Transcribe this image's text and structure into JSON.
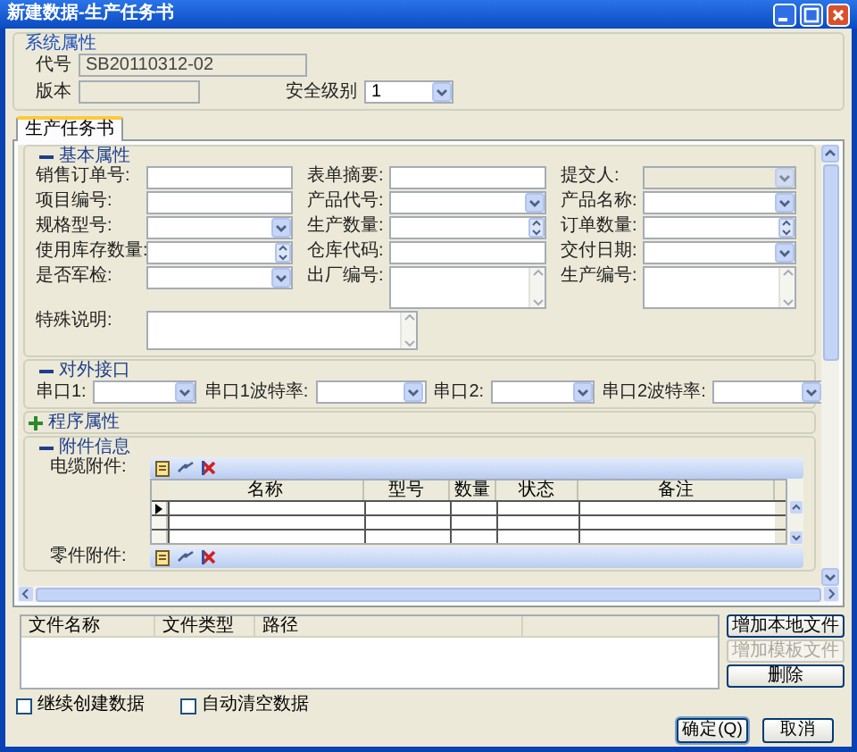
{
  "window": {
    "title": "新建数据-生产任务书"
  },
  "system_group": {
    "title": "系统属性",
    "fields": [
      {
        "label": "代号",
        "value": "SB20110312-02",
        "kind": "text",
        "disabled": true
      },
      {
        "label": "版本",
        "kind": "text",
        "disabled": true
      },
      {
        "label": "安全级别",
        "value": "1",
        "kind": "combo"
      }
    ]
  },
  "tabs": [
    {
      "label": "生产任务书",
      "selected": true
    }
  ],
  "basic_group": {
    "title": "基本属性",
    "expanded": true,
    "fields": [
      {
        "label": "销售订单号:",
        "kind": "text"
      },
      {
        "label": "表单摘要:",
        "kind": "text"
      },
      {
        "label": "提交人:",
        "kind": "combo",
        "disabled": true
      },
      {
        "label": "项目编号:",
        "kind": "text"
      },
      {
        "label": "产品代号:",
        "kind": "combo"
      },
      {
        "label": "产品名称:",
        "kind": "combo"
      },
      {
        "label": "规格型号:",
        "kind": "combo"
      },
      {
        "label": "生产数量:",
        "kind": "spin"
      },
      {
        "label": "订单数量:",
        "kind": "spin"
      },
      {
        "label": "使用库存数量:",
        "kind": "spin"
      },
      {
        "label": "仓库代码:",
        "kind": "text"
      },
      {
        "label": "交付日期:",
        "kind": "combo"
      },
      {
        "label": "是否军检:",
        "kind": "combo"
      },
      {
        "label": "出厂编号:",
        "kind": "memo"
      },
      {
        "label": "生产编号:",
        "kind": "memo"
      }
    ],
    "note": {
      "label": "特殊说明:",
      "kind": "memo"
    }
  },
  "interface_group": {
    "title": "对外接口",
    "expanded": true,
    "fields": [
      {
        "label": "串口1:",
        "kind": "combo"
      },
      {
        "label": "串口1波特率:",
        "kind": "combo"
      },
      {
        "label": "串口2:",
        "kind": "combo"
      },
      {
        "label": "串口2波特率:",
        "kind": "combo"
      }
    ]
  },
  "program_group": {
    "title": "程序属性",
    "expanded": false
  },
  "attachment_group": {
    "title": "附件信息",
    "expanded": true,
    "cable": {
      "label": "电缆附件:",
      "columns": [
        "名称",
        "型号",
        "数量",
        "状态",
        "备注"
      ],
      "rows": [
        {
          "selected": true
        },
        {
          "selected": false
        },
        {
          "selected": false
        }
      ]
    },
    "parts": {
      "label": "零件附件:"
    }
  },
  "files": {
    "columns": [
      "文件名称",
      "文件类型",
      "路径"
    ],
    "buttons": [
      {
        "label": "增加本地文件",
        "disabled": false
      },
      {
        "label": "增加模板文件",
        "disabled": true
      },
      {
        "label": "删除",
        "disabled": false
      }
    ]
  },
  "options": [
    {
      "label": "继续创建数据",
      "checked": false
    },
    {
      "label": "自动清空数据",
      "checked": false
    }
  ],
  "buttons": [
    {
      "label": "确定(Q)",
      "default": true
    },
    {
      "label": "取消",
      "default": false
    }
  ]
}
